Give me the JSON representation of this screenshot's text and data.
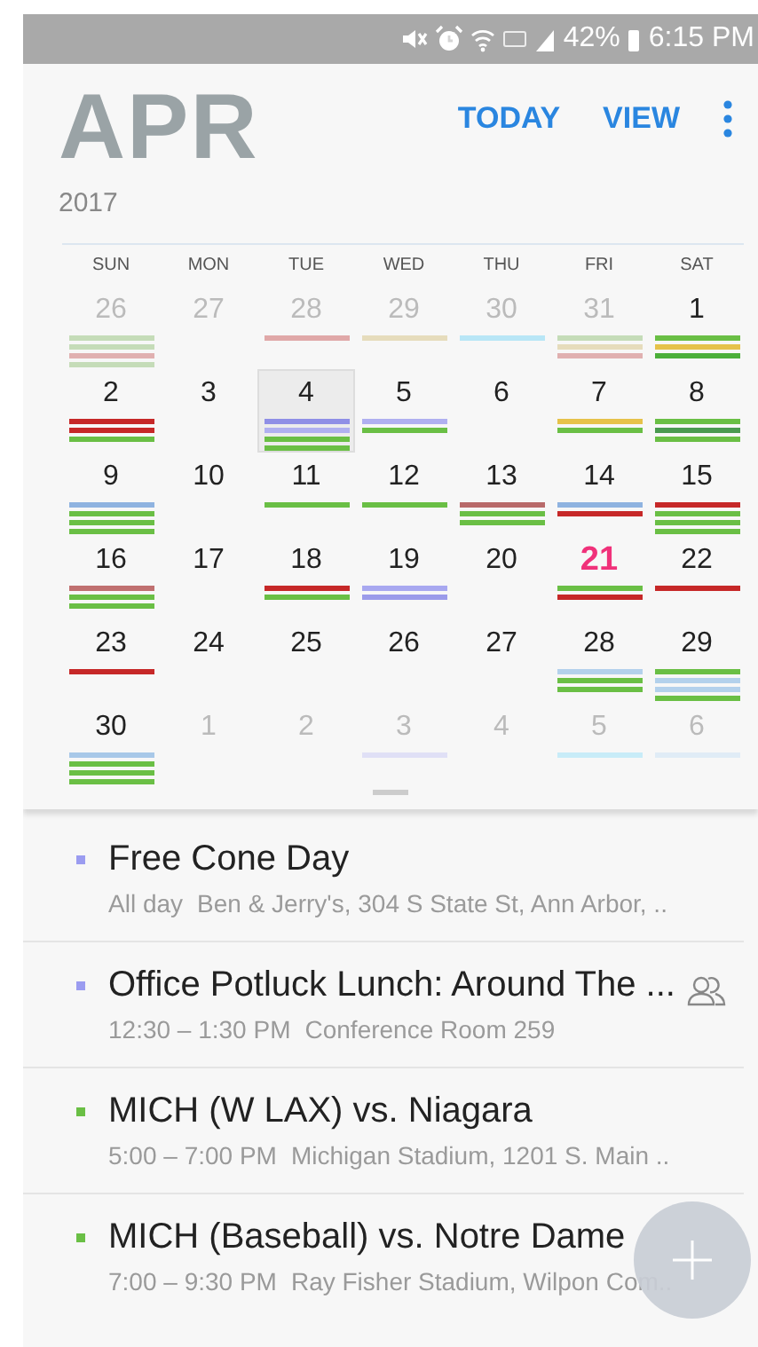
{
  "status_bar": {
    "battery": "42%",
    "time": "6:15 PM"
  },
  "header": {
    "month": "APR",
    "year": "2017",
    "actions": [
      "TODAY",
      "VIEW"
    ]
  },
  "weekdays": [
    "SUN",
    "MON",
    "TUE",
    "WED",
    "THU",
    "FRI",
    "SAT"
  ],
  "weeks": [
    [
      {
        "day": "26",
        "muted": true,
        "selected": false,
        "bars": [
          {
            "color": "#c5dcb8"
          },
          {
            "color": "#c5dcb8"
          },
          {
            "color": "#e0b0b0"
          },
          {
            "color": "#c5dcb8"
          }
        ]
      },
      {
        "day": "27",
        "muted": true,
        "selected": false
      },
      {
        "day": "28",
        "muted": true,
        "selected": false,
        "bars": [
          {
            "color": "#e0a8a8"
          }
        ]
      },
      {
        "day": "29",
        "muted": true,
        "selected": false,
        "bars": [
          {
            "color": "#e6dcbc"
          }
        ]
      },
      {
        "day": "30",
        "muted": true,
        "selected": false,
        "bars": [
          {
            "color": "#b8e6f6"
          }
        ]
      },
      {
        "day": "31",
        "muted": true,
        "selected": false,
        "bars": [
          {
            "color": "#c5dcb8"
          },
          {
            "color": "#e6dcbc"
          },
          {
            "color": "#e0b0b0"
          }
        ]
      },
      {
        "day": "1",
        "selected": false,
        "bars": [
          {
            "color": "#6abf45"
          },
          {
            "color": "#e6c24a"
          },
          {
            "color": "#4caf3a"
          }
        ]
      }
    ],
    [
      {
        "day": "2",
        "selected": false,
        "bars": [
          {
            "color": "#c62828"
          },
          {
            "color": "#c62828"
          },
          {
            "color": "#6abf45"
          }
        ]
      },
      {
        "day": "3",
        "selected": false
      },
      {
        "day": "4",
        "selected": true,
        "bars": [
          {
            "color": "#8f8fe6"
          },
          {
            "color": "#b0b0f0"
          },
          {
            "color": "#6abf45"
          },
          {
            "color": "#6abf45"
          }
        ]
      },
      {
        "day": "5",
        "selected": false,
        "bars": [
          {
            "color": "#b0b0f0"
          },
          {
            "color": "#6abf45"
          }
        ]
      },
      {
        "day": "6",
        "selected": false
      },
      {
        "day": "7",
        "selected": false,
        "bars": [
          {
            "color": "#e6c24a"
          },
          {
            "color": "#6abf45"
          }
        ]
      },
      {
        "day": "8",
        "selected": false,
        "bars": [
          {
            "color": "#6abf45"
          },
          {
            "color": "#4a9a50"
          },
          {
            "color": "#6abf45"
          }
        ]
      }
    ],
    [
      {
        "day": "9",
        "selected": false,
        "bars": [
          {
            "color": "#8fb3e0"
          },
          {
            "color": "#6abf45"
          },
          {
            "color": "#6abf45"
          },
          {
            "color": "#6abf45"
          }
        ]
      },
      {
        "day": "10",
        "selected": false
      },
      {
        "day": "11",
        "selected": false,
        "bars": [
          {
            "color": "#6abf45"
          }
        ]
      },
      {
        "day": "12",
        "selected": false,
        "bars": [
          {
            "color": "#6abf45"
          }
        ]
      },
      {
        "day": "13",
        "selected": false,
        "bars": [
          {
            "color": "#b86a6a"
          },
          {
            "color": "#6abf45"
          },
          {
            "color": "#6abf45"
          }
        ]
      },
      {
        "day": "14",
        "selected": false,
        "bars": [
          {
            "color": "#8fb3e0"
          },
          {
            "color": "#c62828"
          }
        ]
      },
      {
        "day": "15",
        "selected": false,
        "bars": [
          {
            "color": "#c62828"
          },
          {
            "color": "#6abf45"
          },
          {
            "color": "#6abf45"
          },
          {
            "color": "#6abf45"
          }
        ]
      }
    ],
    [
      {
        "day": "16",
        "selected": false,
        "bars": [
          {
            "color": "#c07070"
          },
          {
            "color": "#6abf45"
          },
          {
            "color": "#6abf45"
          }
        ]
      },
      {
        "day": "17",
        "selected": false
      },
      {
        "day": "18",
        "selected": false,
        "bars": [
          {
            "color": "#c62828"
          },
          {
            "color": "#6abf45"
          }
        ]
      },
      {
        "day": "19",
        "selected": false,
        "bars": [
          {
            "color": "#a8a8f0"
          },
          {
            "color": "#9b9bea"
          }
        ]
      },
      {
        "day": "20",
        "selected": false
      },
      {
        "day": "21",
        "selected": false,
        "today": true,
        "bars": [
          {
            "color": "#6abf45"
          },
          {
            "color": "#c62828"
          }
        ]
      },
      {
        "day": "22",
        "selected": false,
        "bars": [
          {
            "color": "#c62828"
          }
        ]
      }
    ],
    [
      {
        "day": "23",
        "selected": false,
        "bars": [
          {
            "color": "#c62828"
          }
        ]
      },
      {
        "day": "24",
        "selected": false
      },
      {
        "day": "25",
        "selected": false
      },
      {
        "day": "26",
        "selected": false
      },
      {
        "day": "27",
        "selected": false
      },
      {
        "day": "28",
        "selected": false,
        "bars": [
          {
            "color": "#b3d1ec"
          },
          {
            "color": "#6abf45"
          },
          {
            "color": "#6abf45"
          }
        ]
      },
      {
        "day": "29",
        "selected": false,
        "bars": [
          {
            "color": "#6abf45"
          },
          {
            "color": "#b3d1ec"
          },
          {
            "color": "#b3d1ec"
          },
          {
            "color": "#6abf45"
          }
        ]
      }
    ],
    [
      {
        "day": "30",
        "selected": false,
        "bars": [
          {
            "color": "#a8c8e8"
          },
          {
            "color": "#6abf45"
          },
          {
            "color": "#6abf45"
          },
          {
            "color": "#6abf45"
          }
        ]
      },
      {
        "day": "1",
        "muted": true,
        "selected": false
      },
      {
        "day": "2",
        "muted": true,
        "selected": false
      },
      {
        "day": "3",
        "muted": true,
        "selected": false,
        "bars": [
          {
            "color": "#e0e0f6"
          }
        ]
      },
      {
        "day": "4",
        "muted": true,
        "selected": false
      },
      {
        "day": "5",
        "muted": true,
        "selected": false,
        "bars": [
          {
            "color": "#c8ecf8"
          }
        ]
      },
      {
        "day": "6",
        "muted": true,
        "selected": false,
        "bars": [
          {
            "color": "#e0ecf6"
          }
        ]
      }
    ]
  ],
  "events": [
    {
      "title": "Free Cone Day",
      "time": "All day",
      "location": "Ben & Jerry's, 304 S State St, Ann Arbor, ..",
      "color": "#9b9cf0"
    },
    {
      "title": "Office Potluck Lunch: Around The ...",
      "time": "12:30 – 1:30 PM",
      "location": "Conference Room 259",
      "color": "#9b9cf0",
      "shared": true
    },
    {
      "title": "MICH (W LAX) vs. Niagara",
      "time": "5:00 – 7:00 PM",
      "location": "Michigan Stadium, 1201 S. Main ..",
      "color": "#6abf45"
    },
    {
      "title": "MICH (Baseball) vs. Notre Dame",
      "time": "7:00 – 9:30 PM",
      "location": "Ray Fisher Stadium, Wilpon Com..",
      "color": "#6abf45"
    }
  ]
}
